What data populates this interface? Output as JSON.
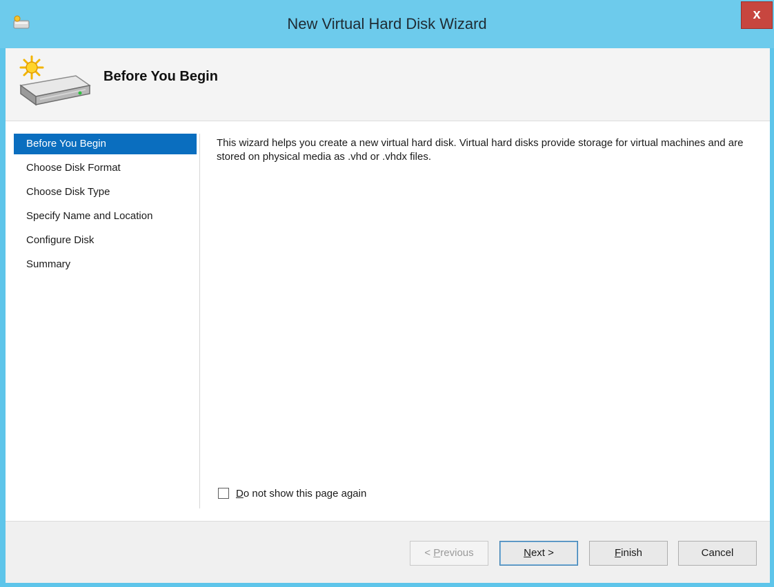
{
  "window": {
    "title": "New Virtual Hard Disk Wizard",
    "close_label": "x"
  },
  "header": {
    "title": "Before You Begin"
  },
  "nav": {
    "items": [
      {
        "label": "Before You Begin",
        "selected": true
      },
      {
        "label": "Choose Disk Format",
        "selected": false
      },
      {
        "label": "Choose Disk Type",
        "selected": false
      },
      {
        "label": "Specify Name and Location",
        "selected": false
      },
      {
        "label": "Configure Disk",
        "selected": false
      },
      {
        "label": "Summary",
        "selected": false
      }
    ]
  },
  "content": {
    "description": "This wizard helps you create a new virtual hard disk. Virtual hard disks provide storage for virtual machines and are stored on physical media as .vhd or .vhdx files.",
    "checkbox": {
      "mnemonic": "D",
      "label_rest": "o not show this page again",
      "checked": false
    }
  },
  "buttons": {
    "previous": {
      "prefix": "< ",
      "mnemonic": "P",
      "rest": "revious",
      "enabled": false
    },
    "next": {
      "mnemonic": "N",
      "rest": "ext >",
      "enabled": true
    },
    "finish": {
      "mnemonic": "F",
      "rest": "inish",
      "enabled": true
    },
    "cancel": {
      "label": "Cancel",
      "enabled": true
    }
  },
  "colors": {
    "titlebar": "#6dcbec",
    "close_button": "#c7463f",
    "nav_selected": "#0a6ebf"
  },
  "icons": {
    "app": "wizard-app-icon",
    "header": "hard-disk-new-icon"
  }
}
